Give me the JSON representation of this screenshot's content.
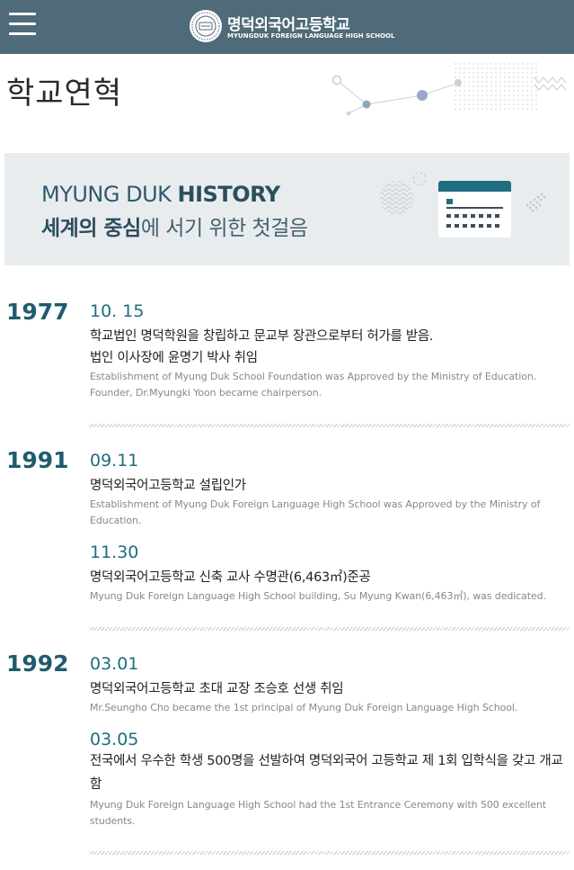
{
  "header": {
    "menu_icon": "hamburger-menu-icon",
    "logo_emblem": "school-emblem",
    "logo_name": "명덕외국어고등학교",
    "logo_sub": "MYUNGDUK FOREIGN LANGUAGE HIGH SCHOOL",
    "background_color": "#4f6a78"
  },
  "page": {
    "title": "학교연혁"
  },
  "banner": {
    "en_plain": "MYUNG DUK ",
    "en_bold": "HISTORY",
    "ko_bold": "세계의 중심",
    "ko_plain": "에 서기 위한 첫걸음",
    "icon": "calendar-icon"
  },
  "history": [
    {
      "year": "1977",
      "events": [
        {
          "date": "10. 15",
          "ko_lines": [
            "학교법인 명덕학원을 창립하고 문교부 장관으로부터 허가를 받음.",
            "법인 이사장에 윤명기 박사 취임"
          ],
          "en": "Establishment of Myung Duk School Foundation was Approved by the Ministry of Education. Founder, Dr.Myungki Yoon became chairperson."
        }
      ]
    },
    {
      "year": "1991",
      "events": [
        {
          "date": "09.11",
          "ko_lines": [
            "명덕외국어고등학교 설립인가"
          ],
          "en": "Establishment of Myung Duk Foreign Language High School was Approved by the Ministry of Education."
        },
        {
          "date": "11.30",
          "ko_lines": [
            "명덕외국어고등학교 신축 교사 수명관(6,463㎡)준공"
          ],
          "en": "Myung Duk Foreign Language High School building, Su Myung Kwan(6,463㎡), was dedicated."
        }
      ]
    },
    {
      "year": "1992",
      "events": [
        {
          "date": "03.01",
          "ko_lines": [
            "명덕외국어고등학교 초대 교장 조승호 선생 취임"
          ],
          "en": "Mr.Seungho Cho became the 1st principal of Myung Duk Foreign Language High School."
        },
        {
          "date": "03.05",
          "ko_lines": [
            "전국에서 우수한 학생 500명을 선발하여 명덕외국어 고등학교 제 1회 입학식을 갖고 개교함"
          ],
          "en": "Myung Duk Foreign Language High School had the 1st Entrance Ceremony with 500 excellent students."
        }
      ]
    }
  ]
}
